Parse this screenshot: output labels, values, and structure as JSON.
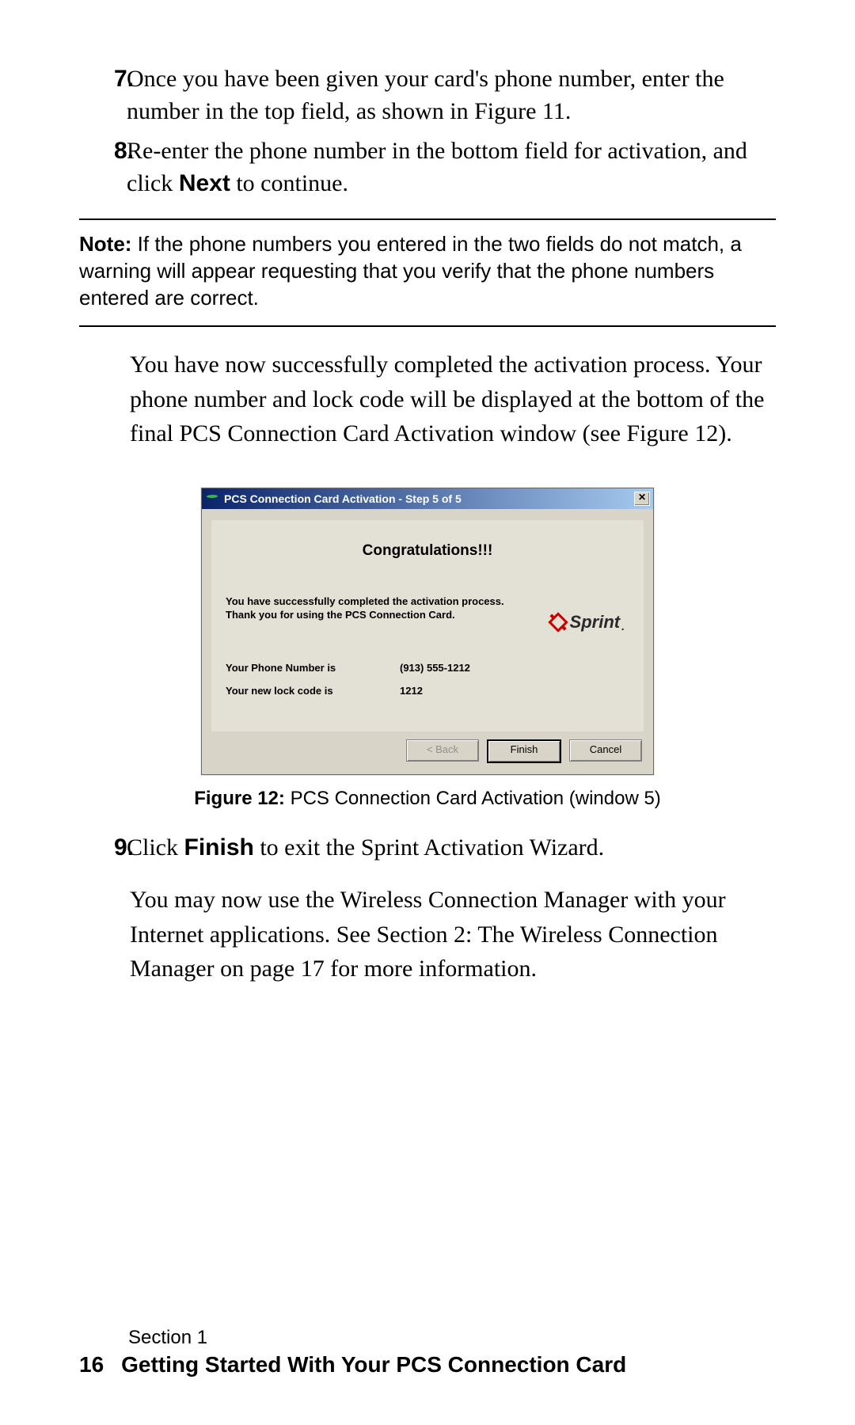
{
  "steps": {
    "s7": {
      "num": "7.",
      "text_a": "Once you have been given your card's phone number, enter the number in the top field, as shown in Figure 11."
    },
    "s8": {
      "num": "8.",
      "text_a": "Re-enter the phone number in the bottom field for activation, and click ",
      "bold": "Next",
      "text_b": " to continue."
    },
    "s9": {
      "num": "9.",
      "text_a": "Click ",
      "bold": "Finish",
      "text_b": " to exit the Sprint Activation Wizard."
    }
  },
  "note": {
    "label": "Note: ",
    "text": "If the phone numbers you entered in the two fields do not match, a warning will appear requesting that you verify that the phone numbers entered are correct."
  },
  "para_success": "You have now successfully completed the activation process. Your phone number and lock code will be displayed at the bottom of the final PCS Connection Card Activation window (see Figure 12).",
  "para_after": "You may now use the Wireless Connection Manager with your Internet applications. See Section 2: The Wireless Connection Manager on page 17 for more information.",
  "dialog": {
    "title": "PCS Connection Card Activation - Step 5 of 5",
    "close": "✕",
    "congrats": "Congratulations!!!",
    "success": "You have successfully completed the activation process. Thank you for using the PCS Connection Card.",
    "sprint": "Sprint",
    "sprint_dot": ".",
    "phone_label": "Your Phone Number is",
    "phone_value": "(913) 555-1212",
    "lock_label": "Your new lock code is",
    "lock_value": "1212",
    "btn_back": "< Back",
    "btn_finish": "Finish",
    "btn_cancel": "Cancel"
  },
  "figure": {
    "label": "Figure 12: ",
    "text": "PCS Connection Card Activation (window 5)"
  },
  "footer": {
    "section": "Section 1",
    "page": "16",
    "title": "Getting Started With Your PCS Connection Card"
  }
}
